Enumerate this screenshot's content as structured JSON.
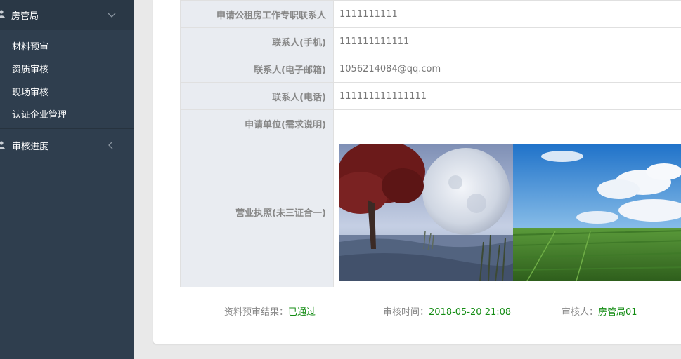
{
  "sidebar": {
    "section1": {
      "label": "房管局"
    },
    "items": [
      {
        "label": "材料预审"
      },
      {
        "label": "资质审核"
      },
      {
        "label": "现场审核"
      },
      {
        "label": "认证企业管理"
      }
    ],
    "section2": {
      "label": "审核进度"
    }
  },
  "table": {
    "rows": [
      {
        "label": "申请公租房工作专职联系人",
        "value": "1111111111"
      },
      {
        "label": "联系人(手机)",
        "value": "111111111111"
      },
      {
        "label": "联系人(电子邮箱)",
        "value": "1056214084@qq.com"
      },
      {
        "label": "联系人(电话)",
        "value": "111111111111111"
      },
      {
        "label": "申请单位(需求说明)",
        "value": ""
      }
    ],
    "license_label": "营业执照(未三证合一)"
  },
  "result": {
    "precheck_label": "资料预审结果：",
    "precheck_value": "已通过",
    "time_label": "审核时间：",
    "time_value": "2018-05-20 21:08",
    "reviewer_label": "审核人：",
    "reviewer_value": "房管局01"
  },
  "icons": {
    "user": "user-icon",
    "chevron_down": "chevron-down-icon",
    "chevron_left": "chevron-left-icon"
  },
  "colors": {
    "sidebar": "#2f3e4e",
    "green": "#138c13",
    "label_bg": "#e9ecf1"
  }
}
